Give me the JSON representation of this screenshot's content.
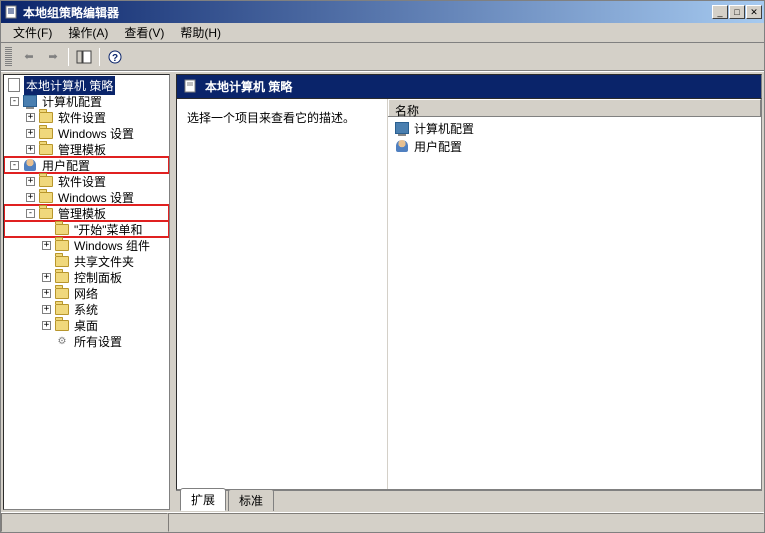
{
  "window": {
    "title": "本地组策略编辑器"
  },
  "menubar": {
    "file": "文件(F)",
    "action": "操作(A)",
    "view": "查看(V)",
    "help": "帮助(H)"
  },
  "tree": {
    "root": "本地计算机 策略",
    "computer_config": "计算机配置",
    "software_settings_1": "软件设置",
    "windows_settings_1": "Windows 设置",
    "admin_templates_1": "管理模板",
    "user_config": "用户配置",
    "software_settings_2": "软件设置",
    "windows_settings_2": "Windows 设置",
    "admin_templates_2": "管理模板",
    "start_menu": "\"开始\"菜单和",
    "windows_components": "Windows 组件",
    "shared_folders": "共享文件夹",
    "control_panel": "控制面板",
    "network": "网络",
    "system": "系统",
    "desktop": "桌面",
    "all_settings": "所有设置"
  },
  "content": {
    "header_title": "本地计算机 策略",
    "description": "选择一个项目来查看它的描述。",
    "column_name": "名称",
    "item_computer": "计算机配置",
    "item_user": "用户配置"
  },
  "tabs": {
    "extended": "扩展",
    "standard": "标准"
  }
}
